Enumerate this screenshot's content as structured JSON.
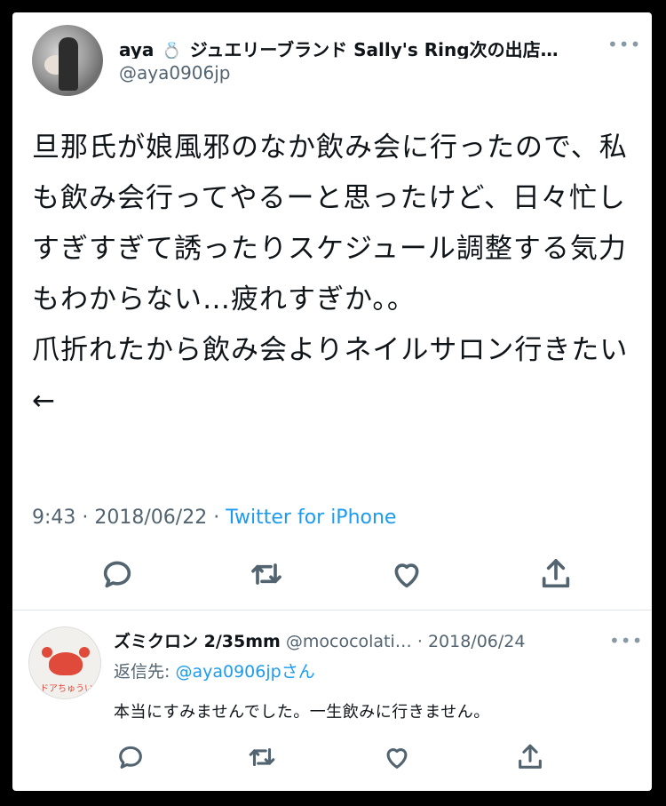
{
  "tweet": {
    "author_name": "aya",
    "author_title": "ジュエリーブランド Sally's Ring次の出店…",
    "handle": "@aya0906jp",
    "more_icon": "more-dots-icon",
    "text": "旦那氏が娘風邪のなか飲み会に行ったので、私も飲み会行ってやるーと思ったけど、日々忙しすぎすぎて誘ったりスケジュール調整する気力もわからない…疲れすぎか。。\n爪折れたから飲み会よりネイルサロン行きたい←",
    "time": "9:43",
    "date": "2018/06/22",
    "source": "Twitter for iPhone",
    "actions": [
      "reply-icon",
      "retweet-icon",
      "like-icon",
      "share-icon"
    ]
  },
  "reply": {
    "author_name": "ズミクロン 2/35mm",
    "handle": "@mococolati…",
    "date": "2018/06/24",
    "replying_to_label": "返信先:",
    "replying_to_handle": "@aya0906jp",
    "replying_to_suffix": "さん",
    "text": "本当にすみませんでした。一生飲みに行きません。",
    "avatar_text": "ドアちゅうい"
  },
  "colors": {
    "link": "#1d9bf0",
    "muted": "#536471",
    "text": "#0f1419",
    "frame": "#000000"
  }
}
